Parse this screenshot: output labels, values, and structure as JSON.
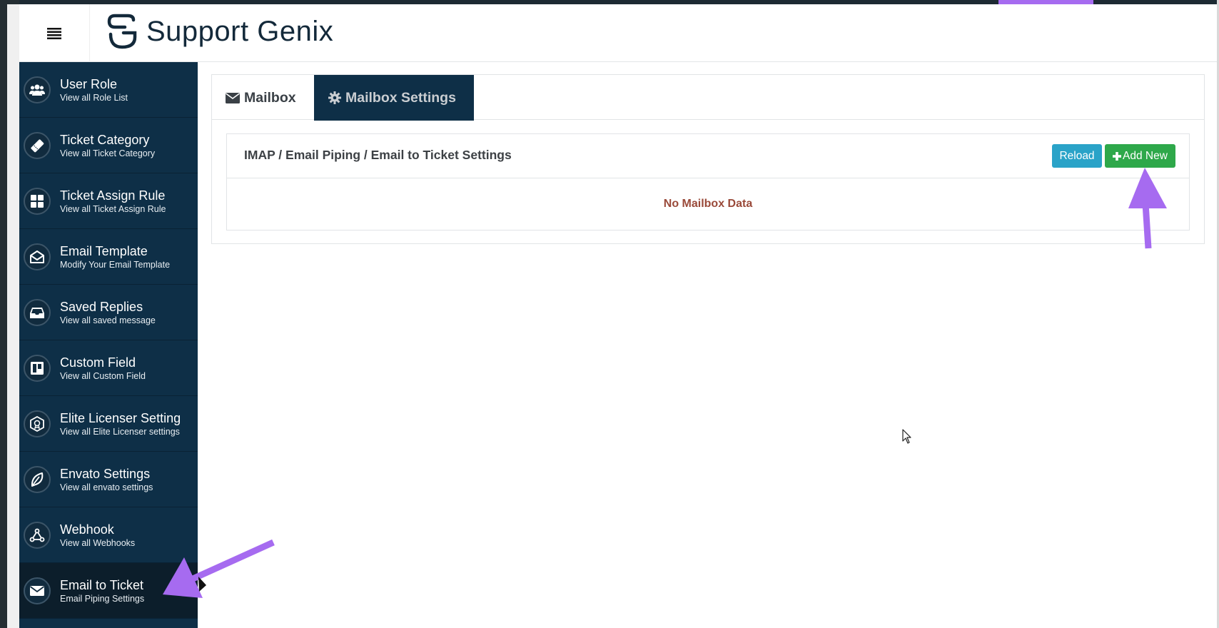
{
  "header": {
    "app_name": "Support Genix"
  },
  "sidebar": {
    "items": [
      {
        "title": "User Role",
        "subtitle": "View all Role List",
        "icon": "users-icon"
      },
      {
        "title": "Ticket Category",
        "subtitle": "View all Ticket Category",
        "icon": "ticket-icon"
      },
      {
        "title": "Ticket Assign Rule",
        "subtitle": "View all Ticket Assign Rule",
        "icon": "grid-icon"
      },
      {
        "title": "Email Template",
        "subtitle": "Modify Your Email Template",
        "icon": "envelope-open-icon"
      },
      {
        "title": "Saved Replies",
        "subtitle": "View all saved message",
        "icon": "inbox-icon"
      },
      {
        "title": "Custom Field",
        "subtitle": "View all Custom Field",
        "icon": "board-icon"
      },
      {
        "title": "Elite Licenser Setting",
        "subtitle": "View all Elite Licenser settings",
        "icon": "license-icon"
      },
      {
        "title": "Envato Settings",
        "subtitle": "View all envato settings",
        "icon": "leaf-icon"
      },
      {
        "title": "Webhook",
        "subtitle": "View all Webhooks",
        "icon": "webhook-icon"
      },
      {
        "title": "Email to Ticket",
        "subtitle": "Email Piping Settings",
        "icon": "envelope-icon",
        "active": true
      }
    ]
  },
  "tabs": {
    "mailbox": "Mailbox",
    "mailbox_settings": "Mailbox Settings"
  },
  "panel": {
    "title": "IMAP / Email Piping / Email to Ticket Settings",
    "reload_label": "Reload",
    "add_new_label": "Add New",
    "empty_message": "No Mailbox Data"
  },
  "colors": {
    "sidebar_bg": "#0e2f47",
    "sidebar_active_bg": "#0c1e2b",
    "reload_button": "#2aa3c8",
    "add_button": "#2ea84a",
    "empty_text": "#9a4a3a",
    "annotation_arrow": "#a66bf0"
  }
}
